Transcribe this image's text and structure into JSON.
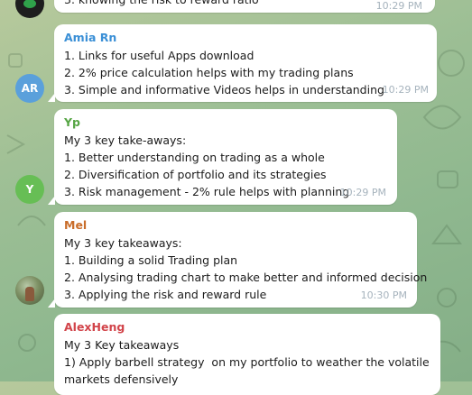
{
  "messages": [
    {
      "sender": "",
      "lines": [
        "3. knowing the risk to reward ratio"
      ],
      "time": "10:29 PM"
    },
    {
      "sender": "Amia Rn",
      "sender_color": "#3a8fd6",
      "avatar": {
        "initials": "AR",
        "color": "#5aa0db"
      },
      "lines": [
        "1. Links for useful Apps download",
        "2. 2% price calculation helps with my trading plans",
        "3. Simple and informative Videos helps in understanding"
      ],
      "time": "10:29 PM"
    },
    {
      "sender": "Yp",
      "sender_color": "#56a544",
      "avatar": {
        "initials": "Y",
        "color": "#67be55"
      },
      "lines": [
        "My 3 key take-aways:",
        "1. Better understanding on trading as a whole",
        "2. Diversification of portfolio and its strategies",
        "3. Risk management - 2% rule helps with planning"
      ],
      "time": "10:29 PM"
    },
    {
      "sender": "Mel",
      "sender_color": "#c96d2a",
      "avatar": {
        "initials": "",
        "color": "#6a7a52",
        "icon": "photo-avatar-icon"
      },
      "lines": [
        "My 3 key takeaways:",
        "1. Building a solid Trading plan",
        "2. Analysing trading chart to make better and informed decision",
        "3. Applying the risk and reward rule"
      ],
      "time": "10:30 PM"
    },
    {
      "sender": "AlexHeng",
      "sender_color": "#d2444a",
      "lines": [
        "My 3 Key takeaways",
        "1) Apply barbell strategy  on my portfolio to weather the volatile",
        "markets defensively"
      ],
      "time": ""
    }
  ]
}
